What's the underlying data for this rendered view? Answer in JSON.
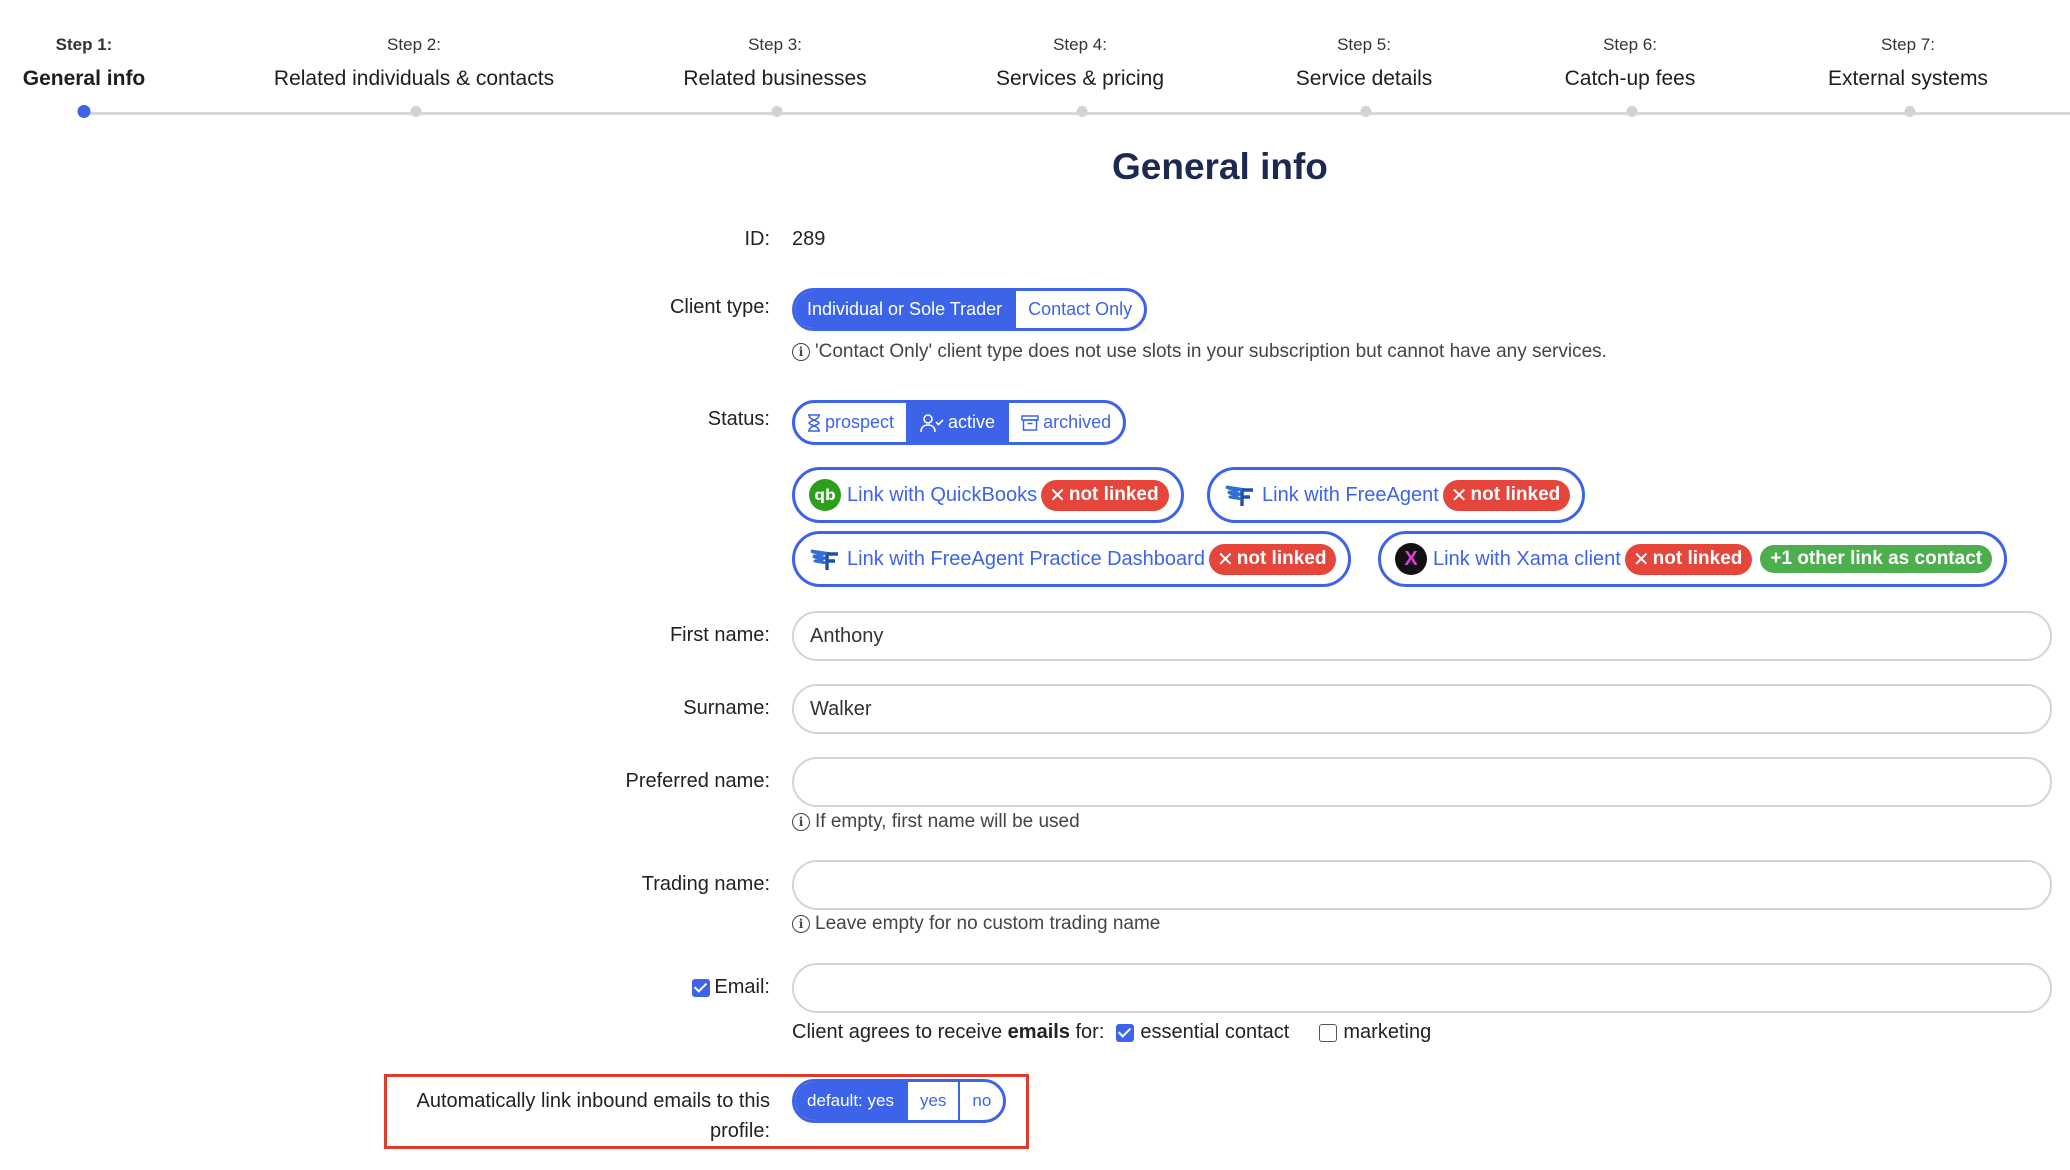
{
  "stepper": {
    "steps": [
      {
        "num": "Step 1:",
        "title": "General info"
      },
      {
        "num": "Step 2:",
        "title": "Related individuals & contacts"
      },
      {
        "num": "Step 3:",
        "title": "Related businesses"
      },
      {
        "num": "Step 4:",
        "title": "Services & pricing"
      },
      {
        "num": "Step 5:",
        "title": "Service details"
      },
      {
        "num": "Step 6:",
        "title": "Catch-up fees"
      },
      {
        "num": "Step 7:",
        "title": "External systems"
      }
    ],
    "active_index": 0
  },
  "page": {
    "title": "General info"
  },
  "form": {
    "id": {
      "label": "ID:",
      "value": "289"
    },
    "client_type": {
      "label": "Client type:",
      "options": [
        "Individual or Sole Trader",
        "Contact Only"
      ],
      "selected": "Individual or Sole Trader",
      "hint": "'Contact Only' client type does not use slots in your subscription but cannot have any services."
    },
    "status": {
      "label": "Status:",
      "options": [
        "prospect",
        "active",
        "archived"
      ],
      "selected": "active"
    },
    "links": {
      "quickbooks": {
        "label": "Link with QuickBooks",
        "badge": "not linked",
        "icon": "quickbooks-icon",
        "icon_text": "qb"
      },
      "freeagent": {
        "label": "Link with FreeAgent",
        "badge": "not linked",
        "icon": "freeagent-icon"
      },
      "freeagent_practice": {
        "label": "Link with FreeAgent Practice Dashboard",
        "badge": "not linked",
        "icon": "freeagent-icon"
      },
      "xama": {
        "label": "Link with Xama client",
        "badge": "not linked",
        "extra_badge": "+1 other link as contact",
        "icon": "xama-icon",
        "icon_text": "X"
      }
    },
    "first_name": {
      "label": "First name:",
      "value": "Anthony"
    },
    "surname": {
      "label": "Surname:",
      "value": "Walker"
    },
    "preferred_name": {
      "label": "Preferred name:",
      "value": "",
      "hint": "If empty, first name will be used"
    },
    "trading_name": {
      "label": "Trading name:",
      "value": "",
      "hint": "Leave empty for no custom trading name"
    },
    "email": {
      "label": "Email:",
      "enabled": true,
      "value": "",
      "consent_prefix": "Client agrees to receive ",
      "consent_bold": "emails",
      "consent_suffix": " for:",
      "essential_contact": {
        "label": "essential contact",
        "checked": true
      },
      "marketing": {
        "label": "marketing",
        "checked": false
      }
    },
    "auto_link": {
      "label_line1": "Automatically link inbound emails to this",
      "label_line2": "profile:",
      "options": [
        "default: yes",
        "yes",
        "no"
      ],
      "selected": "default: yes"
    }
  },
  "colors": {
    "accent": "#3d64e8",
    "danger": "#e5453b",
    "success": "#4cae4c",
    "highlight": "#dd3b2c",
    "title": "#1c2a52"
  }
}
